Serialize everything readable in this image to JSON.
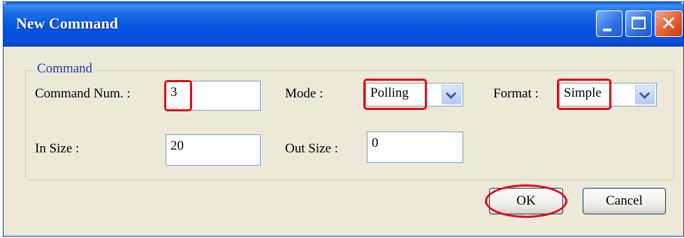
{
  "window": {
    "title": "New Command"
  },
  "command_group": {
    "legend": "Command",
    "command_num_label": "Command Num. :",
    "command_num_value": "3",
    "mode_label": "Mode :",
    "mode_value": "Polling",
    "format_label": "Format :",
    "format_value": "Simple",
    "in_size_label": "In Size :",
    "in_size_value": "20",
    "out_size_label": "Out Size :",
    "out_size_value": "0"
  },
  "buttons": {
    "ok": "OK",
    "cancel": "Cancel"
  },
  "icons": {
    "minimize": "minimize-icon",
    "maximize": "maximize-icon",
    "close": "close-icon",
    "dropdown": "chevron-down-icon"
  },
  "colors": {
    "titlebar": "#0554e0",
    "window_bg": "#ece9d8",
    "highlight": "#e30613",
    "legend_text": "#1f3f9e"
  }
}
